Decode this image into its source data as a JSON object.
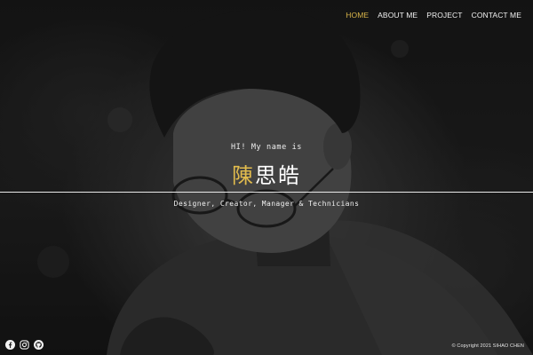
{
  "nav": {
    "items": [
      {
        "label": "HOME",
        "active": true
      },
      {
        "label": "ABOUT ME",
        "active": false
      },
      {
        "label": "PROJECT",
        "active": false
      },
      {
        "label": "CONTACT ME",
        "active": false
      }
    ]
  },
  "hero": {
    "greeting": "HI! My name is",
    "name_first": "陳",
    "name_rest": "思皓",
    "tagline": "Designer, Creator, Manager & Technicians"
  },
  "footer": {
    "social": [
      {
        "icon": "facebook-icon"
      },
      {
        "icon": "instagram-icon"
      },
      {
        "icon": "github-icon"
      }
    ],
    "copyright": "© Copyright 2021 SIHAO CHEN"
  },
  "colors": {
    "accent": "#e2bc4d",
    "text": "#f0f0f0",
    "background": "#1b1b1b"
  }
}
